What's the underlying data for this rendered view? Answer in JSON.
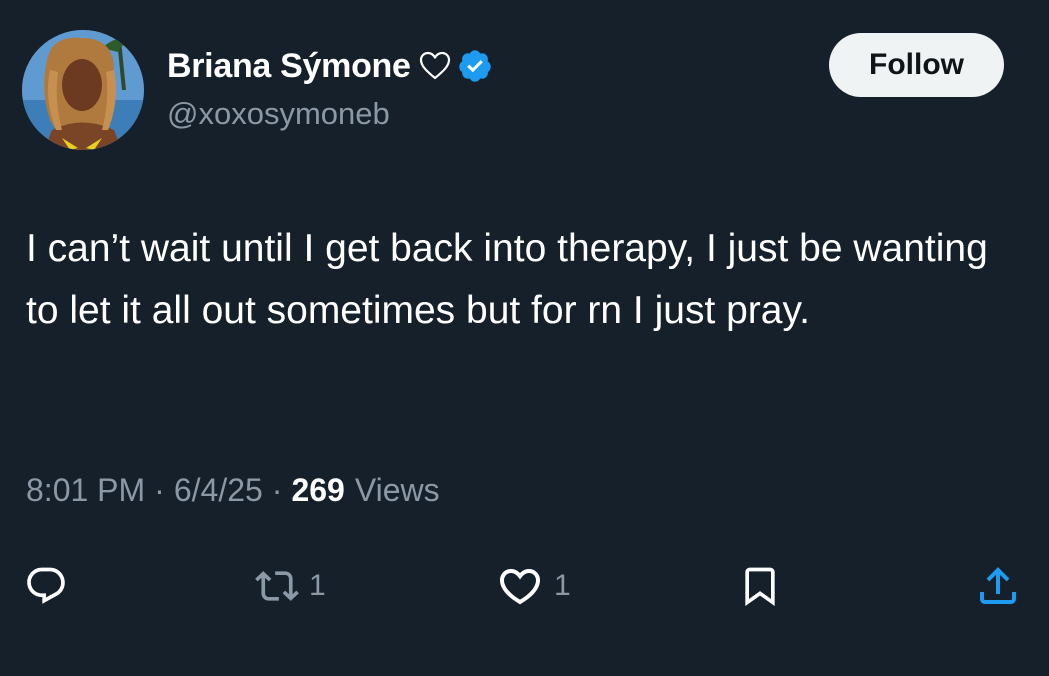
{
  "tweet": {
    "author": {
      "display_name": "Briana Sýmone",
      "handle": "@xoxosymoneb",
      "verified": true,
      "name_emoji": "white-heart-icon",
      "avatar": "profile-photo"
    },
    "follow_label": "Follow",
    "text": "I can’t wait until I get back into therapy, I just be wanting to let it all out sometimes but for rn I just pray.",
    "meta": {
      "time": "8:01 PM",
      "separator": "·",
      "date": "6/4/25",
      "views_count": "269",
      "views_label": "Views"
    },
    "actions": {
      "reply": {
        "icon": "reply-icon",
        "count": ""
      },
      "retweet": {
        "icon": "retweet-icon",
        "count": "1"
      },
      "like": {
        "icon": "heart-icon",
        "count": "1"
      },
      "bookmark": {
        "icon": "bookmark-icon",
        "count": ""
      },
      "share": {
        "icon": "share-icon",
        "count": ""
      }
    }
  },
  "colors": {
    "background": "#15202b",
    "text_primary": "#ffffff",
    "text_secondary": "#8b98a5",
    "verified_blue": "#1d9bf0",
    "follow_button_bg": "#eff3f4",
    "follow_button_text": "#0f1419"
  }
}
